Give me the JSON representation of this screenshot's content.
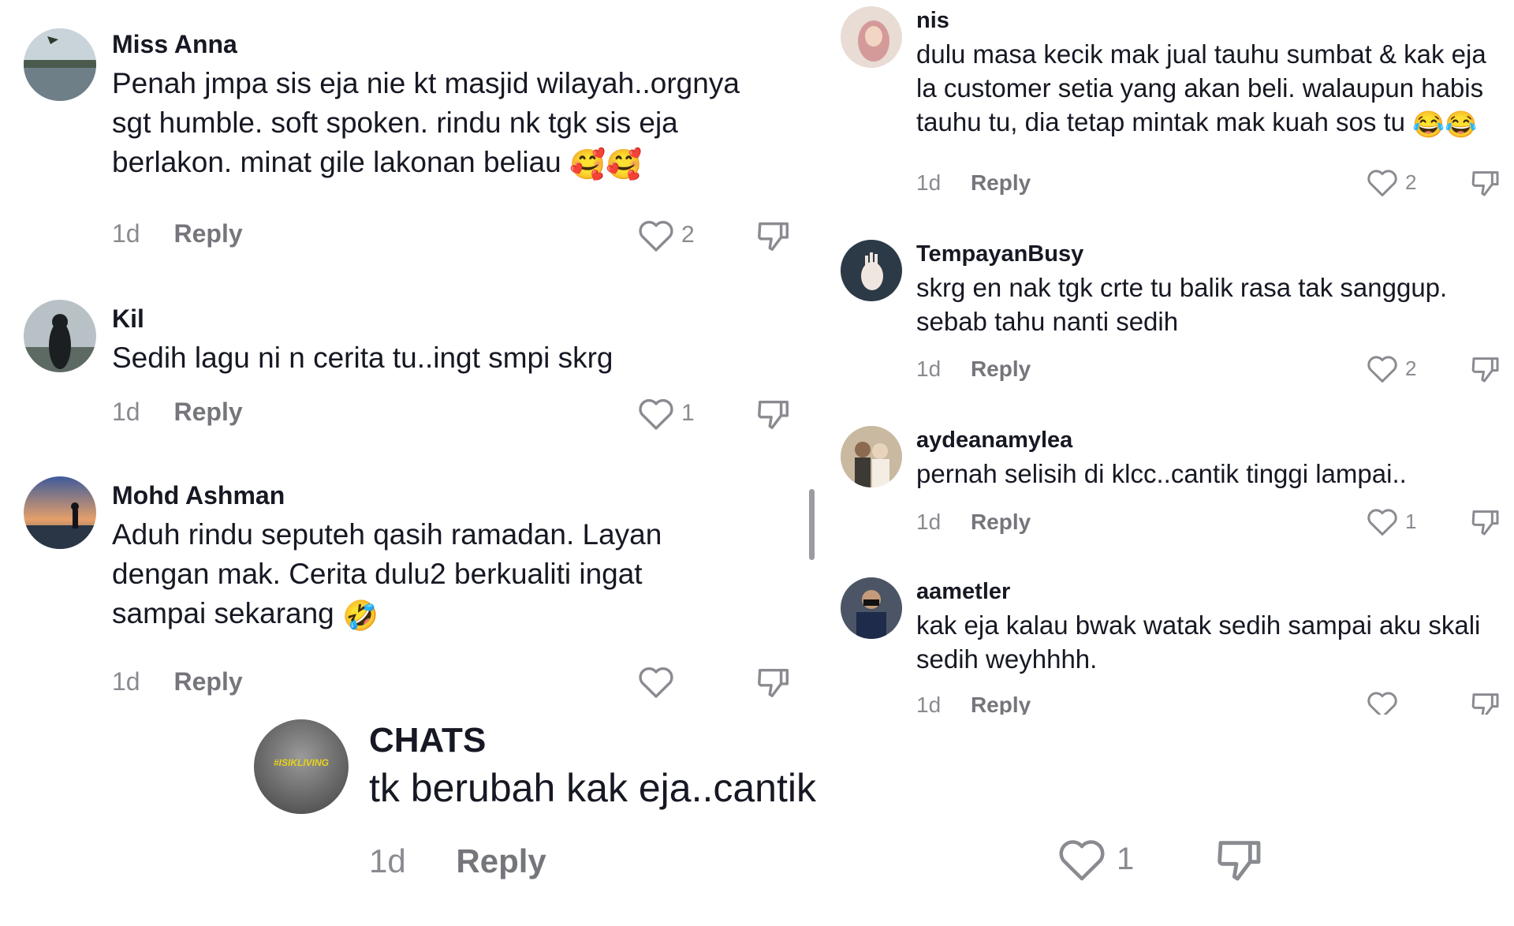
{
  "left_column": [
    {
      "username": "Miss Anna",
      "text": "Penah jmpa sis eja nie kt masjid wilayah..orgnya\nsgt humble. soft spoken. rindu nk tgk sis eja\nberlakon. minat gile lakonan beliau",
      "emoji": "🥰🥰",
      "time": "1d",
      "reply": "Reply",
      "likes": "2"
    },
    {
      "username": "Kil",
      "text": "Sedih lagu ni n cerita tu..ingt smpi skrg",
      "emoji": "",
      "time": "1d",
      "reply": "Reply",
      "likes": "1"
    },
    {
      "username": "Mohd Ashman",
      "text": "Aduh rindu seputeh qasih ramadan. Layan\ndengan mak. Cerita dulu2 berkualiti ingat\nsampai sekarang",
      "emoji": "🤣",
      "time": "1d",
      "reply": "Reply",
      "likes": ""
    }
  ],
  "right_column": [
    {
      "username": "nis",
      "text": "dulu masa kecik mak jual tauhu sumbat & kak eja\nla customer setia yang akan beli. walaupun habis\ntauhu tu, dia tetap mintak mak kuah sos tu",
      "emoji": "😂😂",
      "time": "1d",
      "reply": "Reply",
      "likes": "2"
    },
    {
      "username": "TempayanBusy",
      "text": "skrg en nak tgk crte tu balik rasa tak sanggup.\nsebab tahu nanti sedih",
      "emoji": "",
      "time": "1d",
      "reply": "Reply",
      "likes": "2"
    },
    {
      "username": "aydeanamylea",
      "text": "pernah selisih di klcc..cantik tinggi lampai..",
      "emoji": "",
      "time": "1d",
      "reply": "Reply",
      "likes": "1"
    },
    {
      "username": "aametler",
      "text": "kak eja kalau bwak watak sedih sampai aku skali\nsedih weyhhhh.",
      "emoji": "",
      "time": "1d",
      "reply": "Reply",
      "likes": ""
    }
  ],
  "bottom_comment": {
    "username": "CHATS",
    "avatar_text": "#ISIKLIVING",
    "text": "tk berubah kak eja..cantik",
    "time": "1d",
    "reply": "Reply",
    "likes": "1"
  },
  "icons": {
    "like": "heart-outline-icon",
    "dislike": "thumbs-down-outline-icon"
  },
  "colors": {
    "text": "#161823",
    "muted": "#8a8b91",
    "reply": "#75767c",
    "background": "#ffffff"
  }
}
